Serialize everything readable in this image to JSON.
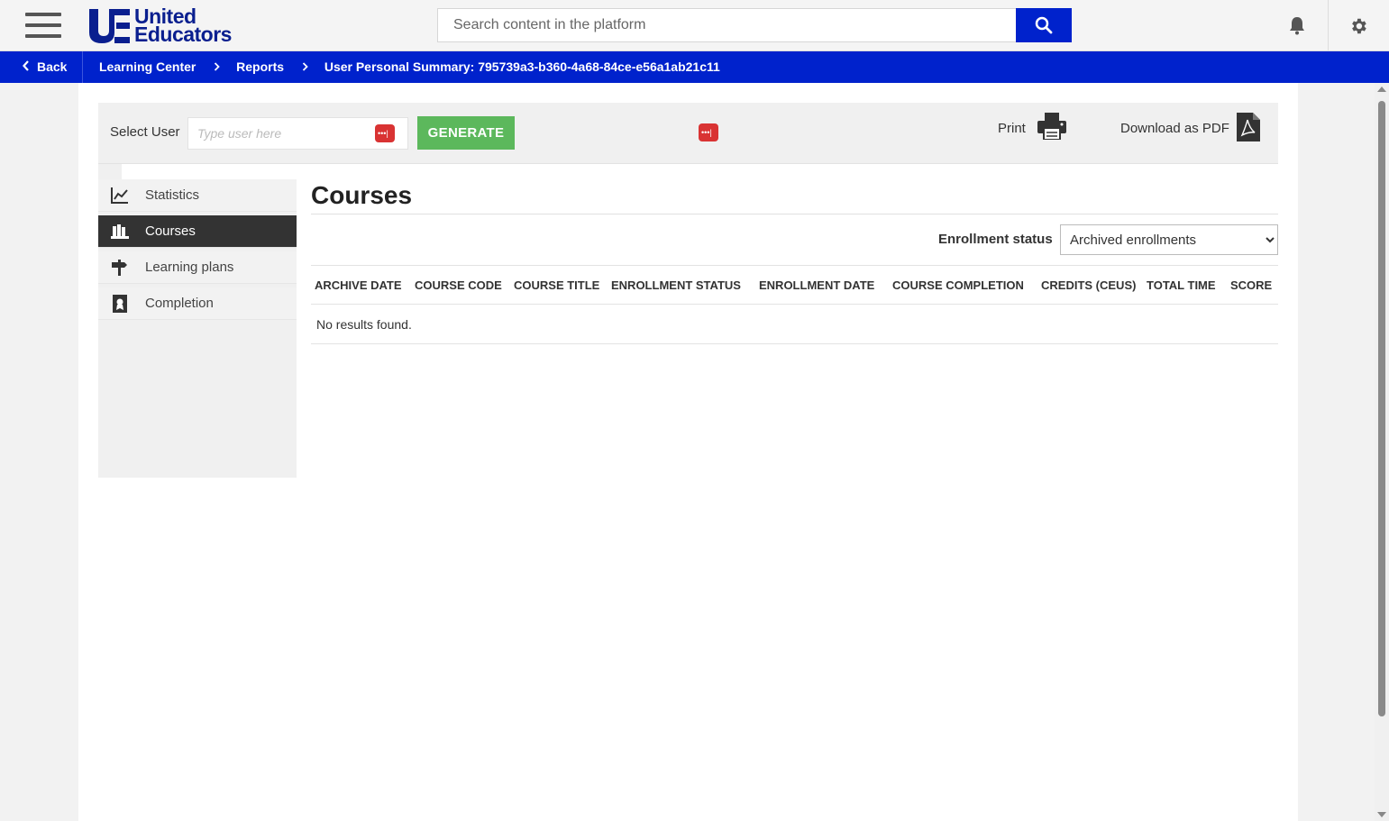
{
  "header": {
    "logo_line1": "United",
    "logo_line2": "Educators",
    "search_placeholder": "Search content in the platform",
    "colors": {
      "brand_blue": "#0022cc",
      "logo_navy": "#0a1f8f"
    }
  },
  "breadcrumb": {
    "back_label": "Back",
    "items": [
      "Learning Center",
      "Reports",
      "User Personal Summary: 795739a3-b360-4a68-84ce-e56a1ab21c11"
    ]
  },
  "toolbar": {
    "select_user_label": "Select User",
    "user_placeholder": "Type user here",
    "generate_label": "GENERATE",
    "print_label": "Print",
    "download_label": "Download as PDF",
    "colors": {
      "generate": "#5cb85c",
      "dots_button": "#d93333"
    }
  },
  "sidenav": {
    "items": [
      {
        "label": "Statistics",
        "icon": "chart-line-icon",
        "active": false
      },
      {
        "label": "Courses",
        "icon": "courses-icon",
        "active": true
      },
      {
        "label": "Learning plans",
        "icon": "signpost-icon",
        "active": false
      },
      {
        "label": "Completion",
        "icon": "certificate-icon",
        "active": false
      }
    ]
  },
  "main": {
    "title": "Courses",
    "enrollment_status_label": "Enrollment status",
    "enrollment_status_value": "Archived enrollments",
    "columns": [
      "ARCHIVE DATE",
      "COURSE CODE",
      "COURSE TITLE",
      "ENROLLMENT STATUS",
      "ENROLLMENT DATE",
      "COURSE COMPLETION",
      "CREDITS (CEUS)",
      "TOTAL TIME",
      "SCORE"
    ],
    "empty_message": "No results found."
  }
}
